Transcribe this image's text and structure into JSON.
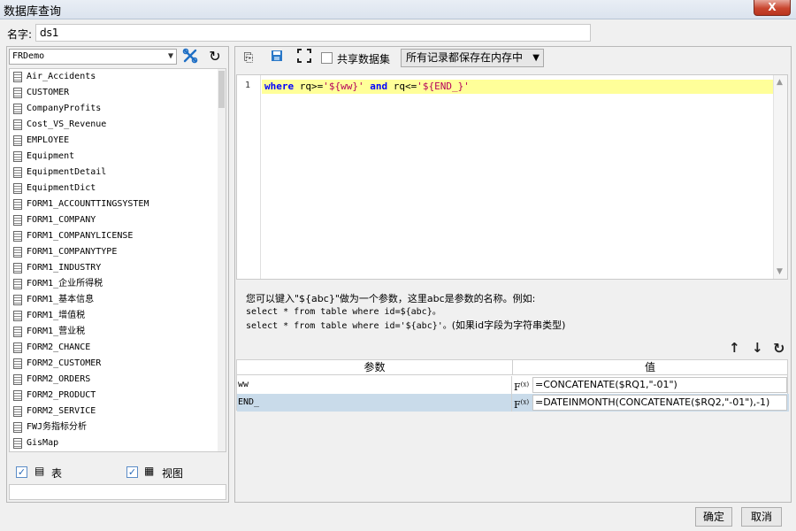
{
  "window": {
    "title": "数据库查询",
    "close_label": "X"
  },
  "name_field": {
    "label": "名字:",
    "value": "ds1"
  },
  "left": {
    "connection": "FRDemo",
    "tables": [
      "Air_Accidents",
      "CUSTOMER",
      "CompanyProfits",
      "Cost_VS_Revenue",
      "EMPLOYEE",
      "Equipment",
      "EquipmentDetail",
      "EquipmentDict",
      "FORM1_ACCOUNTTINGSYSTEM",
      "FORM1_COMPANY",
      "FORM1_COMPANYLICENSE",
      "FORM1_COMPANYTYPE",
      "FORM1_INDUSTRY",
      "FORM1_企业所得税",
      "FORM1_基本信息",
      "FORM1_增值税",
      "FORM1_营业税",
      "FORM2_CHANCE",
      "FORM2_CUSTOMER",
      "FORM2_ORDERS",
      "FORM2_PRODUCT",
      "FORM2_SERVICE",
      "FWJ务指标分析",
      "GisMap"
    ],
    "filter_table_label": "表",
    "filter_view_label": "视图"
  },
  "right": {
    "share_label": "共享数据集",
    "memory_option": "所有记录都保存在内存中",
    "sql": {
      "line_number": "1",
      "kw1": "where",
      "part1": " rq>=",
      "str1": "'${ww}'",
      "kw2": "and",
      "part2": " rq<=",
      "str2": "'${END_}'"
    },
    "help": {
      "line1": "您可以键入\"${abc}\"做为一个参数，这里abc是参数的名称。例如:",
      "line2": "select * from table where id=${abc}。",
      "line3a": "select * from table where id='${abc}'。",
      "line3b": "(如果id字段为字符串类型)"
    },
    "params": {
      "col_name": "参数",
      "col_value": "值",
      "rows": [
        {
          "name": "ww",
          "value": "=CONCATENATE($RQ1,\"-01\")"
        },
        {
          "name": "END_",
          "value": "=DATEINMONTH(CONCATENATE($RQ2,\"-01\"),-1)"
        }
      ]
    }
  },
  "footer": {
    "ok": "确定",
    "cancel": "取消"
  }
}
